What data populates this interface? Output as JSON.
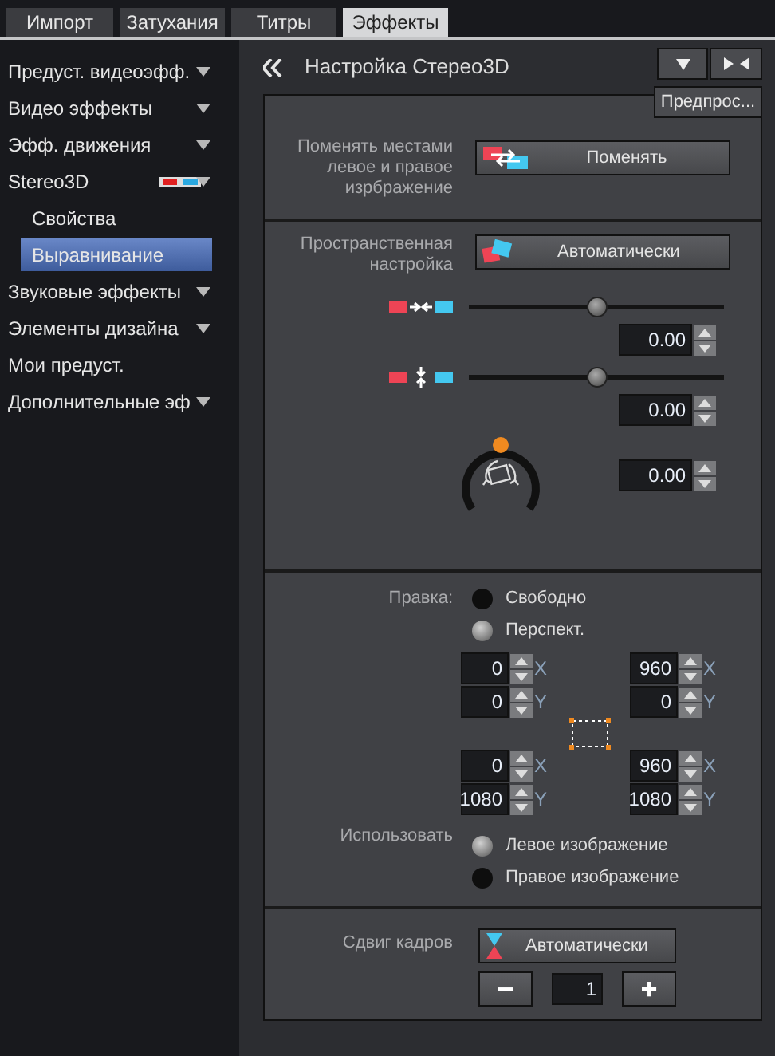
{
  "tabs": [
    {
      "label": "Импорт",
      "selected": false
    },
    {
      "label": "Затухания",
      "selected": false
    },
    {
      "label": "Титры",
      "selected": false
    },
    {
      "label": "Эффекты",
      "selected": true
    }
  ],
  "sidebar": {
    "items": [
      {
        "label": "Предуст. видеоэфф.",
        "has_menu": true,
        "selected": false
      },
      {
        "label": "Видео эффекты",
        "has_menu": true,
        "selected": false
      },
      {
        "label": "Эфф. движения",
        "has_menu": true,
        "selected": false
      },
      {
        "label": "Stereo3D",
        "has_menu": true,
        "selected": false,
        "kind": "stereo3d",
        "children": [
          {
            "label": "Свойства",
            "selected": false
          },
          {
            "label": "Выравнивание",
            "selected": true
          }
        ]
      },
      {
        "label": "Звуковые эффекты",
        "has_menu": true,
        "selected": false
      },
      {
        "label": "Элементы дизайна",
        "has_menu": true,
        "selected": false
      },
      {
        "label": "Мои предуст.",
        "has_menu": false,
        "selected": false
      },
      {
        "label": "Дополнительные эф",
        "has_menu": true,
        "selected": false
      }
    ]
  },
  "panel": {
    "title": "Настройка Стерео3D",
    "preview_button": "Предпрос...",
    "swap": {
      "label": "Поменять местами левое и правое изрбражение",
      "button": "Поменять"
    },
    "spatial": {
      "label": "Пространственная настройка",
      "button": "Автоматически",
      "sliders": [
        {
          "kind": "horizontal",
          "level": 0.5,
          "value": "0.00"
        },
        {
          "kind": "vertical",
          "level": 0.5,
          "value": "0.00"
        }
      ],
      "rotation": {
        "value": "0.00"
      }
    },
    "correction": {
      "label": "Правка:",
      "modes": [
        {
          "label": "Свободно",
          "selected": false
        },
        {
          "label": "Перспект.",
          "selected": true
        }
      ],
      "corners": [
        [
          {
            "value": "0",
            "axis": "X"
          },
          {
            "value": "0",
            "axis": "Y"
          }
        ],
        [
          {
            "value": "960",
            "axis": "X"
          },
          {
            "value": "0",
            "axis": "Y"
          }
        ],
        [
          {
            "value": "0",
            "axis": "X"
          },
          {
            "value": "1080",
            "axis": "Y"
          }
        ],
        [
          {
            "value": "960",
            "axis": "X"
          },
          {
            "value": "1080",
            "axis": "Y"
          }
        ]
      ],
      "use_label": "Использовать",
      "use_options": [
        {
          "label": "Левое изображение",
          "selected": true
        },
        {
          "label": "Правое изображение",
          "selected": false
        }
      ]
    },
    "frame_shift": {
      "label": "Сдвиг кадров",
      "button": "Автоматически",
      "value": "1",
      "minus": "−",
      "plus": "+"
    }
  }
}
